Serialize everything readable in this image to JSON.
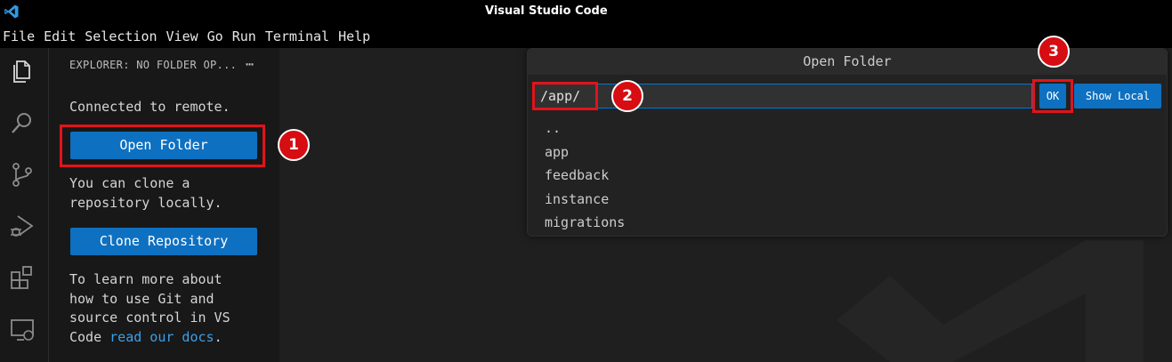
{
  "window": {
    "title": "Visual Studio Code"
  },
  "menu": [
    "File",
    "Edit",
    "Selection",
    "View",
    "Go",
    "Run",
    "Terminal",
    "Help"
  ],
  "activity_bar": [
    "files-icon",
    "search-icon",
    "source-control-icon",
    "run-debug-icon",
    "extensions-icon",
    "remote-explorer-icon"
  ],
  "sidebar": {
    "title": "EXPLORER: NO FOLDER OP...",
    "more": "⋯",
    "connected_text": "Connected to remote.",
    "open_folder_label": "Open Folder",
    "clone_text_line1": "You can clone a",
    "clone_text_line2": "repository locally.",
    "clone_button_label": "Clone Repository",
    "learn_line1": "To learn more about",
    "learn_line2": "how to use Git and",
    "learn_line3": "source control in VS",
    "learn_line4_prefix": "Code ",
    "learn_link": "read our docs",
    "learn_suffix": "."
  },
  "quick_pick": {
    "title": "Open Folder",
    "input_value": "/app/",
    "ok_label": "OK",
    "show_local_label": "Show Local",
    "items": [
      "..",
      "app",
      "feedback",
      "instance",
      "migrations"
    ]
  },
  "annotations": {
    "m1": "1",
    "m2": "2",
    "m3": "3"
  },
  "colors": {
    "accent": "#0e70c0",
    "highlight": "#e0141b",
    "marker": "#d60d12",
    "link": "#3b9fe8"
  }
}
